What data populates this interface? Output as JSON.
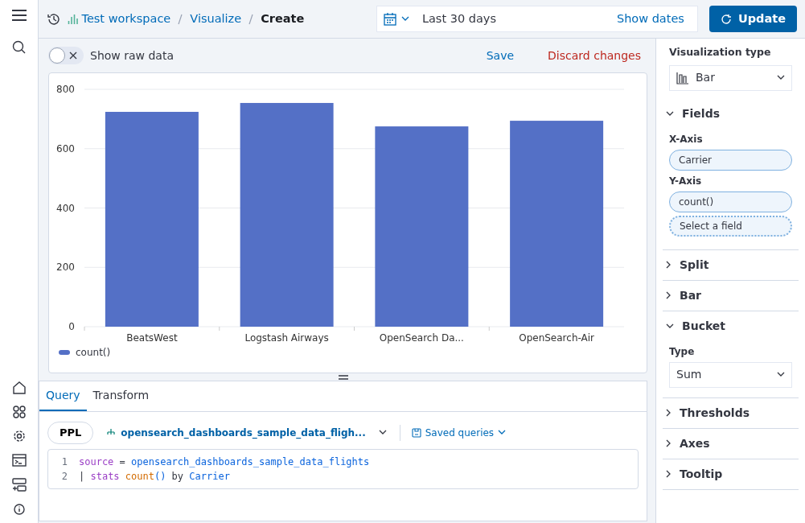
{
  "breadcrumbs": [
    {
      "text": "Test workspace",
      "kind": "workspace"
    },
    {
      "text": "Visualize",
      "kind": "link"
    },
    {
      "text": "Create",
      "kind": "current"
    }
  ],
  "date_picker": {
    "range": "Last 30 days",
    "show_dates": "Show dates"
  },
  "update_button": "Update",
  "toolbar": {
    "raw_data_toggle": {
      "label": "Show raw data",
      "on": false
    },
    "save": "Save",
    "discard": "Discard changes"
  },
  "chart_data": {
    "type": "bar",
    "categories": [
      "BeatsWest",
      "Logstash Airways",
      "OpenSearch Da...",
      "OpenSearch-Air"
    ],
    "series": [
      {
        "name": "count()",
        "color": "#5470c6",
        "values": [
          724,
          754,
          675,
          694
        ]
      }
    ],
    "ylim": [
      0,
      800
    ],
    "grid": true,
    "yticks": [
      0,
      200,
      400,
      600,
      800
    ]
  },
  "query_tabs": [
    {
      "label": "Query",
      "selected": true
    },
    {
      "label": "Transform",
      "selected": false
    }
  ],
  "query": {
    "language": "PPL",
    "dataset": "opensearch_dashboards_sample_data_fligh...",
    "saved_queries": "Saved queries",
    "lines": [
      {
        "number": "1",
        "tokens": [
          {
            "text": "source",
            "kind": "keyword"
          },
          {
            "text": " = ",
            "kind": "plain"
          },
          {
            "text": "opensearch_dashboards_sample_data_flights",
            "kind": "name"
          }
        ]
      },
      {
        "number": "2",
        "tokens": [
          {
            "text": "| ",
            "kind": "plain"
          },
          {
            "text": "stats",
            "kind": "keyword"
          },
          {
            "text": " count",
            "kind": "function"
          },
          {
            "text": "()",
            "kind": "name"
          },
          {
            "text": " by ",
            "kind": "plain"
          },
          {
            "text": "Carrier",
            "kind": "name"
          }
        ]
      }
    ]
  },
  "panel": {
    "title": "Visualization type",
    "type_select": "Bar",
    "sections": [
      {
        "title": "Fields",
        "expanded": true,
        "items": [
          {
            "kind": "label",
            "text": "X-Axis"
          },
          {
            "kind": "chip",
            "text": "Carrier"
          },
          {
            "kind": "label",
            "text": "Y-Axis"
          },
          {
            "kind": "chip",
            "text": "count()"
          },
          {
            "kind": "empty_chip",
            "text": "Select a field"
          }
        ]
      },
      {
        "title": "Split",
        "expanded": false
      },
      {
        "title": "Bar",
        "expanded": false
      },
      {
        "title": "Bucket",
        "expanded": true,
        "items": [
          {
            "kind": "label",
            "text": "Type"
          },
          {
            "kind": "select",
            "text": "Sum"
          }
        ]
      },
      {
        "title": "Thresholds",
        "expanded": false
      },
      {
        "title": "Axes",
        "expanded": false
      },
      {
        "title": "Tooltip",
        "expanded": false
      }
    ]
  }
}
